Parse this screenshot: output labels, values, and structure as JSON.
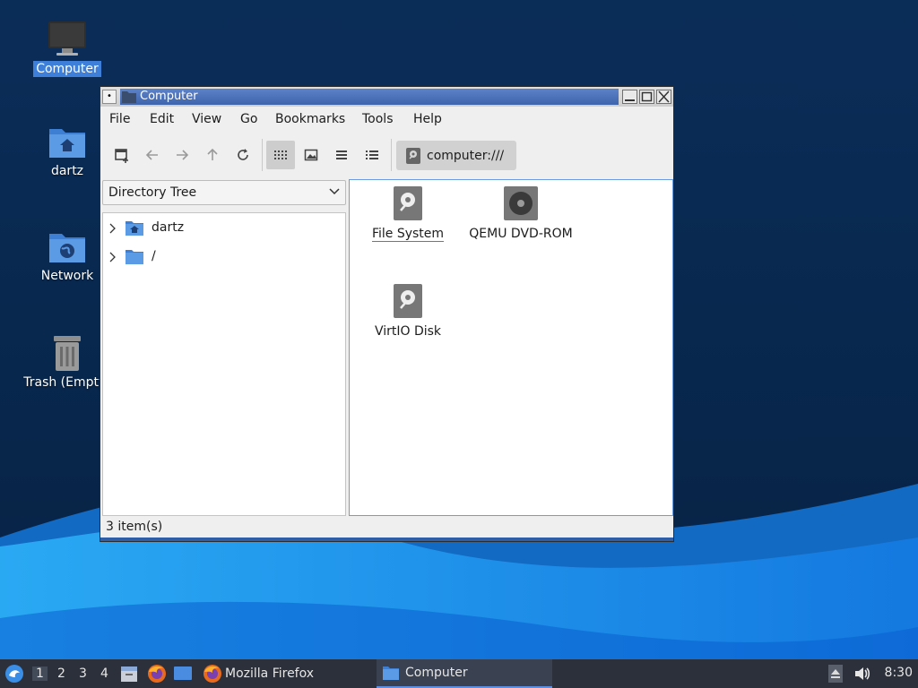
{
  "desktop": {
    "icons": [
      {
        "label": "Computer",
        "icon": "computer-monitor-icon",
        "selected": true
      },
      {
        "label": "dartz",
        "icon": "home-folder-icon"
      },
      {
        "label": "Network",
        "icon": "network-folder-icon"
      },
      {
        "label": "Trash (Empty)",
        "icon": "trash-icon"
      }
    ]
  },
  "window": {
    "title": "Computer",
    "menu": [
      "File",
      "Edit",
      "View",
      "Go",
      "Bookmarks",
      "Tools",
      "Help"
    ],
    "toolbar": {
      "buttons": [
        "new-tab-icon",
        "back-arrow-icon",
        "forward-arrow-icon",
        "up-arrow-icon",
        "reload-icon",
        "icon-view-icon",
        "thumbnail-view-icon",
        "compact-view-icon",
        "detailed-list-icon"
      ],
      "active_view": "icon-view-icon"
    },
    "location": "computer:///",
    "side_pane": {
      "mode": "Directory Tree",
      "items": [
        {
          "label": "dartz",
          "icon": "home-folder-icon"
        },
        {
          "label": "/",
          "icon": "folder-icon"
        }
      ]
    },
    "files": [
      {
        "label": "File System",
        "icon": "hard-disk-icon",
        "focused": true
      },
      {
        "label": "QEMU DVD-ROM",
        "icon": "optical-disc-icon"
      },
      {
        "label": "VirtIO Disk",
        "icon": "hard-disk-icon"
      }
    ],
    "status": "3 item(s)"
  },
  "taskbar": {
    "workspaces": [
      "1",
      "2",
      "3",
      "4"
    ],
    "active_workspace": "1",
    "launchers": [
      "file-manager-icon",
      "firefox-icon",
      "show-desktop-icon"
    ],
    "tasks": [
      {
        "label": "Mozilla Firefox",
        "icon": "firefox-icon"
      },
      {
        "label": "Computer",
        "icon": "folder-icon",
        "active": true
      }
    ],
    "tray": [
      "eject-icon",
      "volume-icon"
    ],
    "clock": "8:30"
  },
  "colors": {
    "desktop_dark": "#07264a",
    "desktop_wave": "#1d8fe8",
    "selection": "#3d7fd9",
    "titlebar_active": "#4a6fb8",
    "taskbar": "#2b303a"
  }
}
